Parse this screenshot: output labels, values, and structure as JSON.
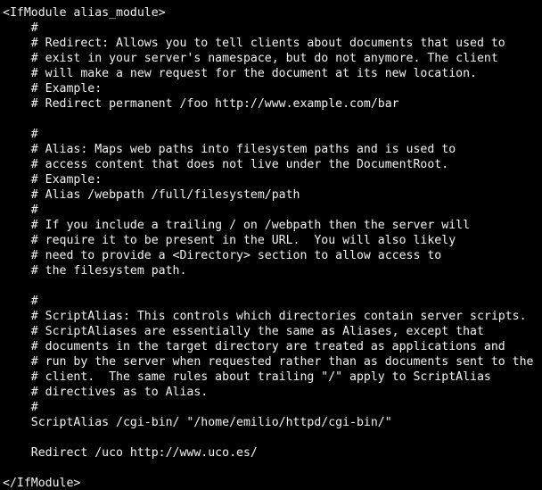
{
  "terminal": {
    "colors": {
      "background": "#000000",
      "text": "#f2f2f2"
    },
    "lines": [
      "<IfModule alias_module>",
      "    #",
      "    # Redirect: Allows you to tell clients about documents that used to",
      "    # exist in your server's namespace, but do not anymore. The client",
      "    # will make a new request for the document at its new location.",
      "    # Example:",
      "    # Redirect permanent /foo http://www.example.com/bar",
      "",
      "    #",
      "    # Alias: Maps web paths into filesystem paths and is used to",
      "    # access content that does not live under the DocumentRoot.",
      "    # Example:",
      "    # Alias /webpath /full/filesystem/path",
      "    #",
      "    # If you include a trailing / on /webpath then the server will",
      "    # require it to be present in the URL.  You will also likely",
      "    # need to provide a <Directory> section to allow access to",
      "    # the filesystem path.",
      "",
      "    #",
      "    # ScriptAlias: This controls which directories contain server scripts.",
      "    # ScriptAliases are essentially the same as Aliases, except that",
      "    # documents in the target directory are treated as applications and",
      "    # run by the server when requested rather than as documents sent to the",
      "    # client.  The same rules about trailing \"/\" apply to ScriptAlias",
      "    # directives as to Alias.",
      "    #",
      "    ScriptAlias /cgi-bin/ \"/home/emilio/httpd/cgi-bin/\"",
      "",
      "    Redirect /uco http://www.uco.es/",
      "",
      "</IfModule>"
    ]
  }
}
